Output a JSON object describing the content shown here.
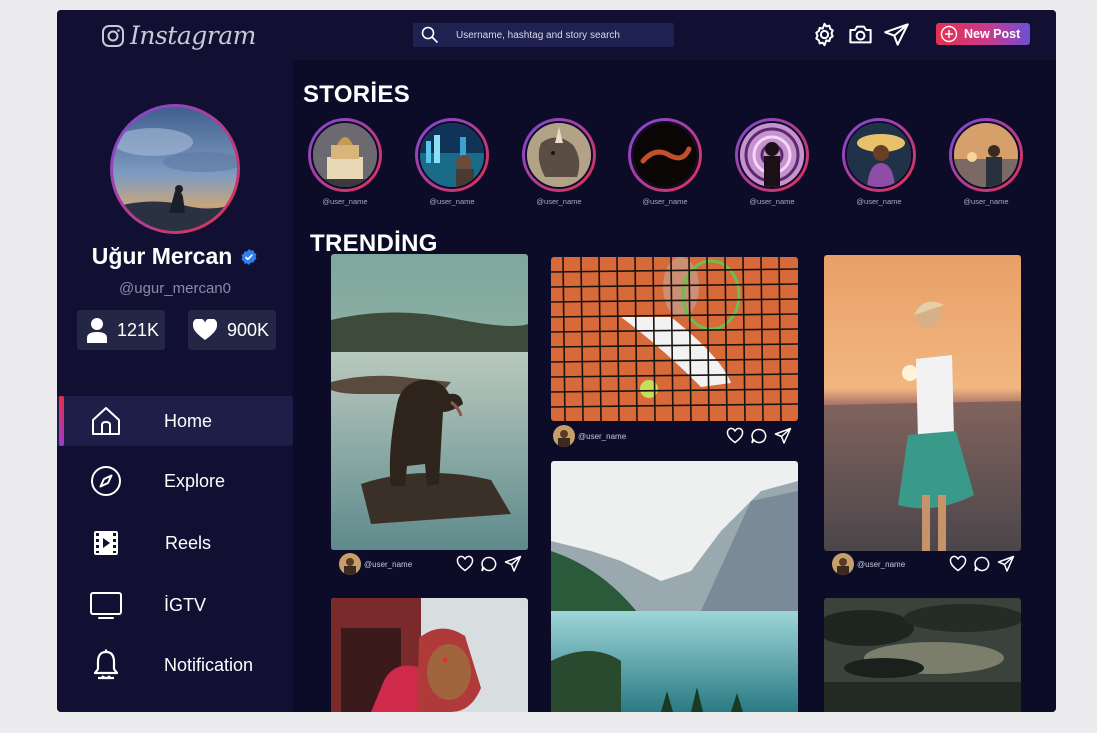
{
  "app": {
    "logo_text": "Instagram"
  },
  "search": {
    "placeholder": "Username, hashtag and story search"
  },
  "topbar": {
    "new_post_label": "New Post"
  },
  "profile": {
    "name": "Uğur Mercan",
    "handle": "@ugur_mercan0",
    "followers": "121K",
    "likes": "900K"
  },
  "nav": {
    "items": [
      {
        "label": "Home",
        "icon": "home-icon",
        "active": true
      },
      {
        "label": "Explore",
        "icon": "compass-icon",
        "active": false
      },
      {
        "label": "Reels",
        "icon": "reels-icon",
        "active": false
      },
      {
        "label": "İGTV",
        "icon": "tv-icon",
        "active": false
      },
      {
        "label": "Notification",
        "icon": "bell-icon",
        "active": false
      }
    ]
  },
  "stories": {
    "title": "STORİES",
    "items": [
      {
        "name": "@user_name"
      },
      {
        "name": "@user_name"
      },
      {
        "name": "@user_name"
      },
      {
        "name": "@user_name"
      },
      {
        "name": "@user_name"
      },
      {
        "name": "@user_name"
      },
      {
        "name": "@user_name"
      }
    ]
  },
  "trending": {
    "title": "TRENDİNG",
    "posts": [
      {
        "user": "@user_name"
      },
      {
        "user": "@user_name"
      },
      {
        "user": "@user_name"
      }
    ]
  },
  "colors": {
    "background": "#13123a",
    "accent_gradient_start": "#e3314f",
    "accent_gradient_end": "#6c4fd6",
    "verified": "#2f7ff0"
  }
}
